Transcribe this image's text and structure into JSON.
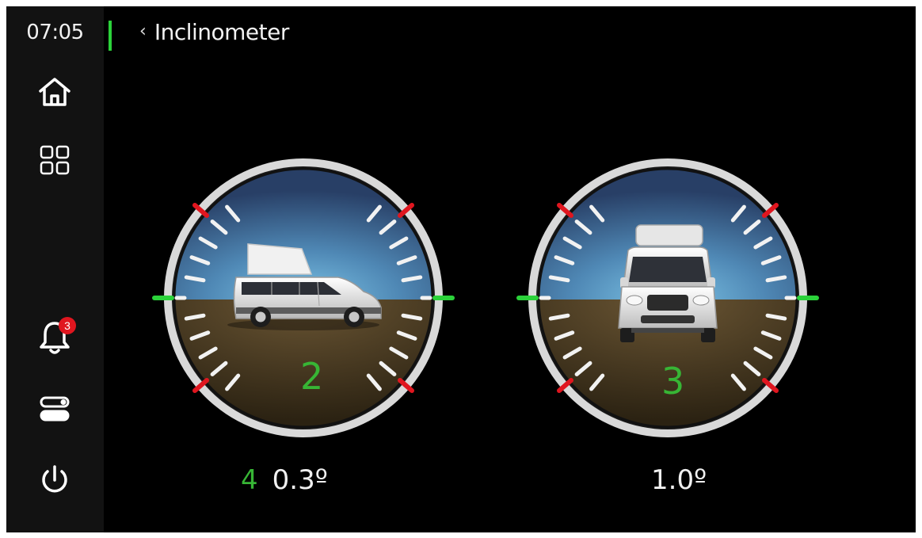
{
  "status": {
    "time": "07:05"
  },
  "header": {
    "back_icon": "chevron-left-icon",
    "title": "Inclinometer"
  },
  "sidebar": {
    "items": [
      {
        "icon": "home-icon"
      },
      {
        "icon": "apps-grid-icon"
      },
      {
        "icon": "bell-icon",
        "badge": "3"
      },
      {
        "icon": "switches-icon"
      },
      {
        "icon": "power-icon"
      }
    ]
  },
  "gauges": {
    "side": {
      "marker_number": "2",
      "index_label": "4",
      "reading": "0.3º"
    },
    "front": {
      "marker_number": "3",
      "reading": "1.0º"
    }
  },
  "colors": {
    "accent_green": "#37b535",
    "alert_red": "#e0161f",
    "sky_blue": "#5b93bd",
    "ground_brown": "#4e3f26"
  }
}
